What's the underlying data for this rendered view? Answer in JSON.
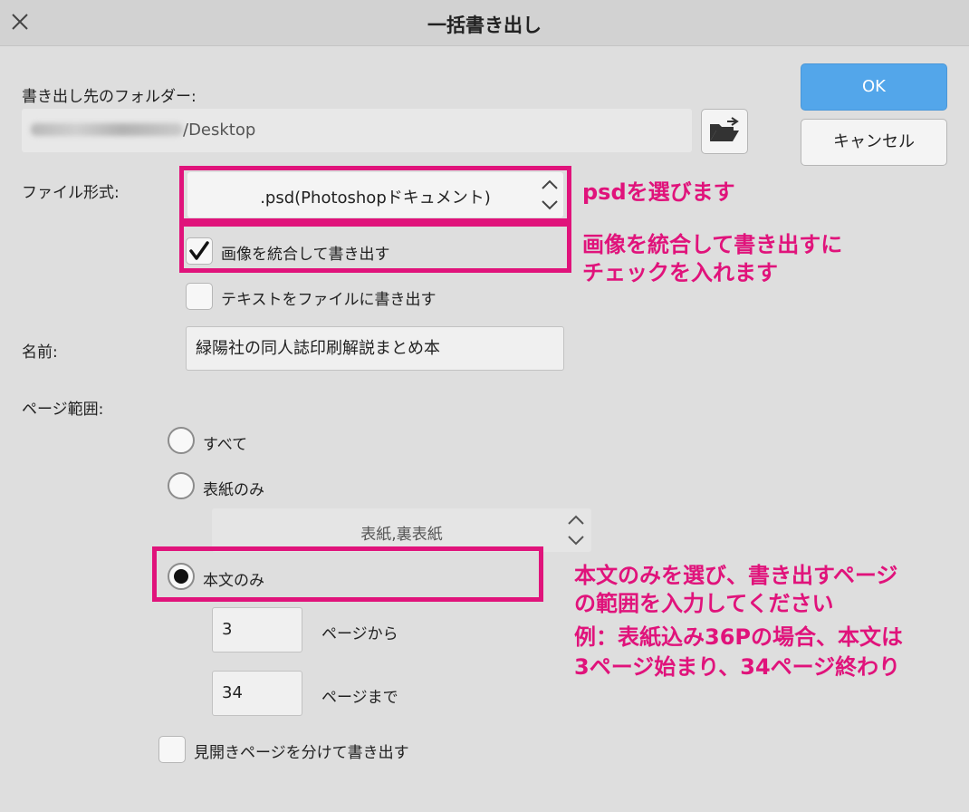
{
  "window": {
    "title": "一括書き出し"
  },
  "buttons": {
    "ok": "OK",
    "cancel": "キャンセル"
  },
  "destination": {
    "label": "書き出し先のフォルダー:",
    "path_suffix": "/Desktop"
  },
  "file_format": {
    "label": "ファイル形式:",
    "selected": ".psd(Photoshopドキュメント)"
  },
  "options": {
    "merge_layers": {
      "label": "画像を統合して書き出す",
      "checked": true
    },
    "text_export": {
      "label": "テキストをファイルに書き出す",
      "checked": false
    }
  },
  "name": {
    "label": "名前:",
    "value": "緑陽社の同人誌印刷解説まとめ本"
  },
  "page_range": {
    "label": "ページ範囲:",
    "all": "すべて",
    "cover_only": "表紙のみ",
    "cover_select": "表紙,裏表紙",
    "body_only": "本文のみ",
    "selected": "body_only",
    "from_value": "3",
    "from_label": "ページから",
    "to_value": "34",
    "to_label": "ページまで"
  },
  "spread": {
    "label": "見開きページを分けて書き出す",
    "checked": false
  },
  "annotations": {
    "a1": "psdを選びます",
    "a2_line1": "画像を統合して書き出すに",
    "a2_line2": "チェックを入れます",
    "a3_line1": "本文のみを選び、書き出すページ",
    "a3_line2": "の範囲を入力してください",
    "a3_line3": "例：表紙込み36Pの場合、本文は",
    "a3_line4": "3ページ始まり、34ページ終わり"
  },
  "colors": {
    "accent": "#53a6ea",
    "highlight": "#e0137b",
    "background": "#dedede"
  },
  "icons": [
    "close-icon",
    "folder-open-icon",
    "chevron-updown-icon",
    "checkmark-icon"
  ]
}
